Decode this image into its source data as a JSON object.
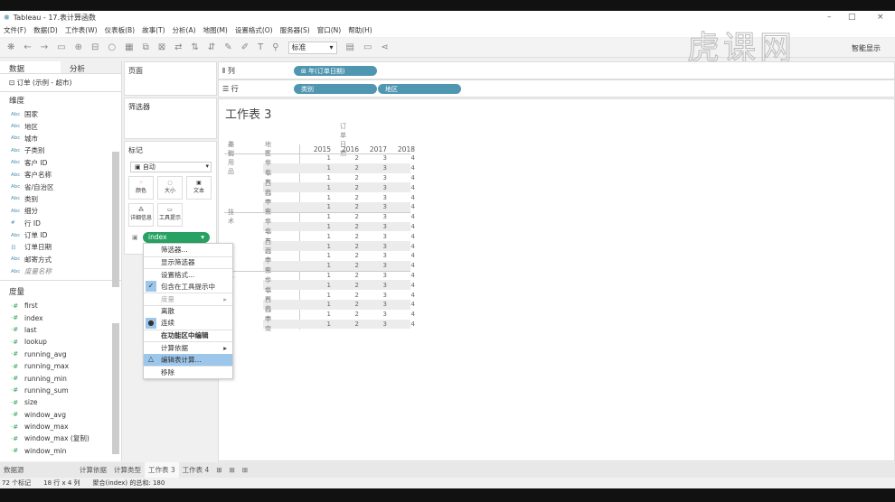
{
  "window": {
    "title": "Tableau - 17.表计算函数",
    "watermark": "虎课网",
    "min": "–",
    "max": "□",
    "close": "×"
  },
  "menu": [
    "文件(F)",
    "数据(D)",
    "工作表(W)",
    "仪表板(B)",
    "故事(T)",
    "分析(A)",
    "地图(M)",
    "设置格式(O)",
    "服务器(S)",
    "窗口(N)",
    "帮助(H)"
  ],
  "toolbar": {
    "fit_select": "标准",
    "show_me": "智能显示"
  },
  "left": {
    "tab_data": "数据",
    "tab_analysis": "分析",
    "source": "订单 (示例 - 超市)",
    "dimensions_label": "维度",
    "dimensions": [
      {
        "t": "Abc",
        "n": "国家"
      },
      {
        "t": "Abc",
        "n": "地区"
      },
      {
        "t": "Abc",
        "n": "城市"
      },
      {
        "t": "Abc",
        "n": "子类别"
      },
      {
        "t": "Abc",
        "n": "客户 ID"
      },
      {
        "t": "Abc",
        "n": "客户名称"
      },
      {
        "t": "Abc",
        "n": "省/自治区"
      },
      {
        "t": "Abc",
        "n": "类别"
      },
      {
        "t": "Abc",
        "n": "细分"
      },
      {
        "t": "#",
        "n": "行 ID"
      },
      {
        "t": "Abc",
        "n": "订单 ID"
      },
      {
        "t": "日",
        "n": "订单日期"
      },
      {
        "t": "Abc",
        "n": "邮寄方式"
      },
      {
        "t": "Abc",
        "n": "度量名称"
      }
    ],
    "measures_label": "度量",
    "measures": [
      "first",
      "index",
      "last",
      "lookup",
      "running_avg",
      "running_max",
      "running_min",
      "running_sum",
      "size",
      "window_avg",
      "window_max",
      "window_max (复制)",
      "window_min"
    ]
  },
  "pages_label": "页面",
  "filters_label": "筛选器",
  "marks": {
    "label": "标记",
    "type": "自动",
    "color": "颜色",
    "size": "大小",
    "text": "文本",
    "detail": "详细信息",
    "tooltip": "工具提示",
    "pill": "index"
  },
  "shelves": {
    "columns_label": "列",
    "rows_label": "行",
    "columns": [
      "⊞ 年(订单日期)"
    ],
    "rows": [
      "类别",
      "地区"
    ]
  },
  "sheet": {
    "title": "工作表 3",
    "col_header": "订单日期",
    "h_category": "类别",
    "h_region": "地区",
    "years": [
      "2015",
      "2016",
      "2017",
      "2018"
    ],
    "categories": [
      "办公用品",
      "技术",
      "具"
    ],
    "regions": [
      "东北",
      "华北",
      "华东",
      "西北",
      "西南",
      "中南"
    ],
    "values": [
      1,
      2,
      3,
      4
    ]
  },
  "context_menu": [
    {
      "l": "筛选器..."
    },
    {
      "l": "显示筛选器",
      "sep": 1
    },
    {
      "l": "设置格式...",
      "sep": 1
    },
    {
      "l": "包含在工具提示中",
      "mk": "✓"
    },
    {
      "l": "度量",
      "sep": 1,
      "dis": 1,
      "sub": 1
    },
    {
      "l": "离散",
      "sep": 1
    },
    {
      "l": "连续",
      "mk": "●"
    },
    {
      "l": "在功能区中编辑",
      "sep": 1,
      "b": 1
    },
    {
      "l": "计算依据",
      "sep": 1,
      "sub": 1
    },
    {
      "l": "编辑表计算...",
      "mk": "△",
      "hl": 1
    },
    {
      "l": "移除",
      "sep": 1
    }
  ],
  "tabs": [
    "数据源",
    "计算依据",
    "计算类型",
    "工作表 3",
    "工作表 4"
  ],
  "status": [
    "72 个标记",
    "18 行 x 4 列",
    "聚合(index) 的总和: 180"
  ]
}
